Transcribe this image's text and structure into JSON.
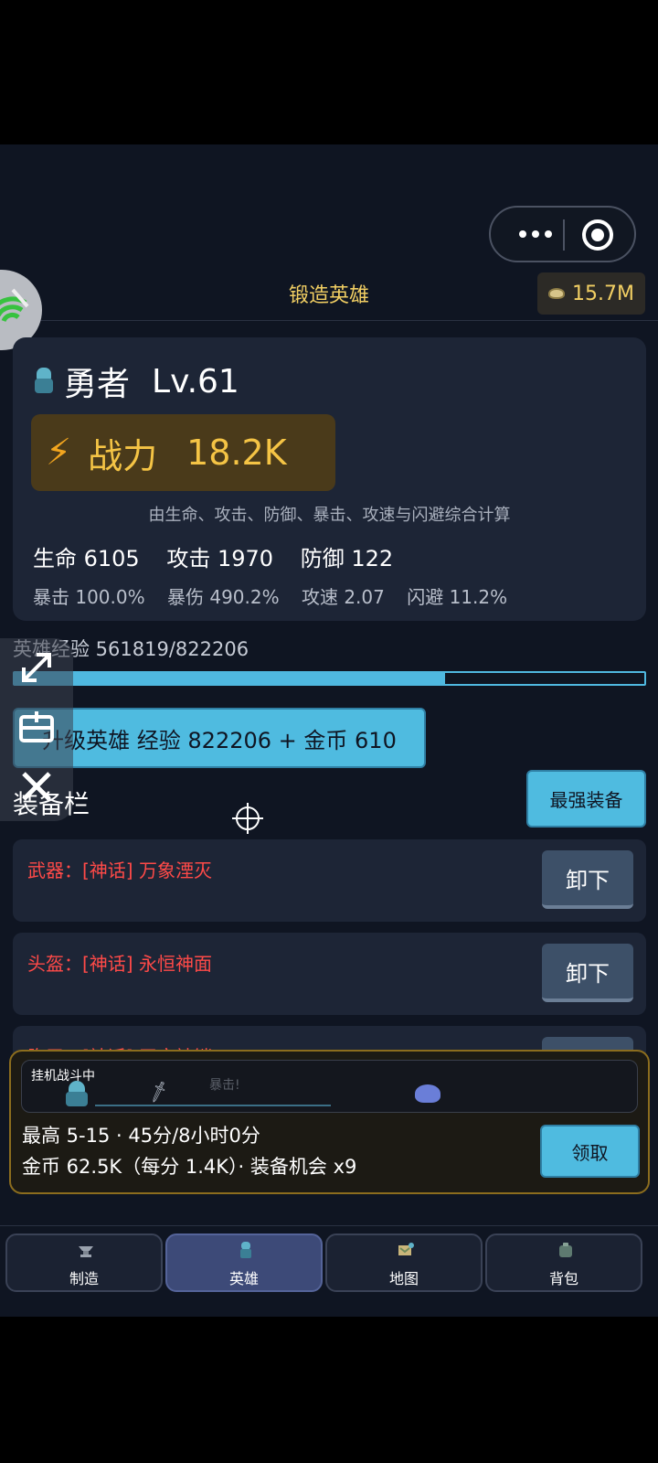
{
  "topbar": {
    "title": "锻造英雄",
    "gold": "15.7M"
  },
  "hero": {
    "name": "勇者",
    "level": "Lv.61",
    "power_label": "战力",
    "power_value": "18.2K",
    "note": "由生命、攻击、防御、暴击、攻速与闪避综合计算",
    "stats1": [
      "生命 6105",
      "攻击 1970",
      "防御 122"
    ],
    "stats2": [
      "暴击 100.0%",
      "暴伤 490.2%",
      "攻速 2.07",
      "闪避 11.2%"
    ]
  },
  "exp": {
    "label": "英雄经验 561819/822206",
    "progress": 0.683
  },
  "upgrade_button": "升级英雄  经验 822206 + 金币 610",
  "equipment": {
    "title": "装备栏",
    "best_button": "最强装备",
    "slots": [
      {
        "text": "武器：[神话] 万象湮灭",
        "button": "卸下"
      },
      {
        "text": "头盔：[神话] 永恒神面",
        "button": "卸下"
      },
      {
        "text": "胸甲：[神话] 天穹神铠",
        "button": "卸下"
      }
    ]
  },
  "idle": {
    "status": "挂机战斗中",
    "crit_text": "暴击!",
    "line1": "最高 5-15 · 45分/8小时0分",
    "line2": "金币 62.5K（每分 1.4K）· 装备机会 x9",
    "claim_button": "领取"
  },
  "nav": {
    "tabs": [
      {
        "label": "制造",
        "icon": "anvil-icon"
      },
      {
        "label": "英雄",
        "icon": "hero-icon",
        "active": true
      },
      {
        "label": "地图",
        "icon": "map-icon"
      },
      {
        "label": "背包",
        "icon": "bag-icon"
      }
    ]
  }
}
